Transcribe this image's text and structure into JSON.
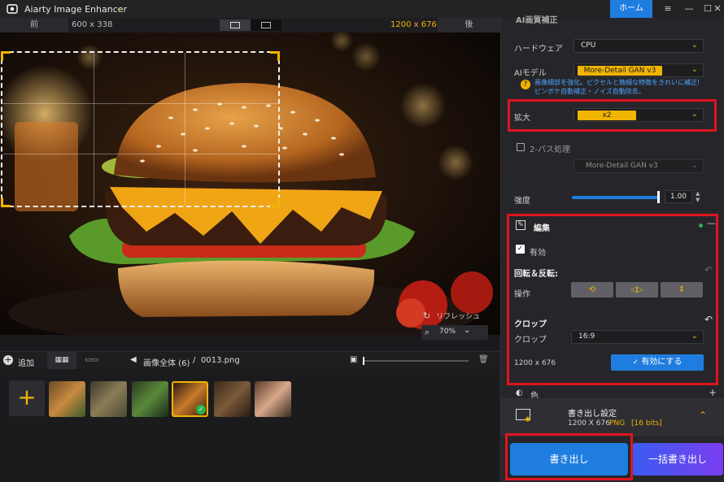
{
  "app": {
    "title": "Aiarty Image Enhancer",
    "home_label": "ホーム",
    "window_controls": [
      "≡",
      "—",
      "☐",
      "✕"
    ]
  },
  "compare": {
    "before_label": "前",
    "before_size": "600 x 338",
    "after_size": "1200 x 676",
    "after_label": "後"
  },
  "canvas": {
    "refresh_label": "リフレッシュ",
    "zoom_value": "70%"
  },
  "bottom": {
    "add_label": "追加",
    "path_all": "画像全体 (6)",
    "path_sep": "/",
    "path_file": "0013.png",
    "thumbs": [
      "tiger",
      "lizard",
      "forest",
      "burger",
      "dog",
      "woman"
    ],
    "selected_thumb": "burger"
  },
  "panel": {
    "section_title_partial": "AI画質補正",
    "hardware_label": "ハードウェア",
    "hardware_value": "CPU",
    "ai_model_label": "AIモデル",
    "ai_model_value": "More-Detail GAN  v3",
    "ai_model_hint_line1": "画像細部を強化。ピクセルと微細な特徴をきれいに補正!",
    "ai_model_hint_line2": "ピンボケ自動補正・ノイズ自動除去。",
    "scale_label": "拡大",
    "scale_value": "x2",
    "two_pass_label": "2-パス処理",
    "two_pass_model": "More-Detail GAN  v3",
    "strength_label": "強度",
    "strength_value": "1.00",
    "edit": {
      "title": "編集",
      "enabled_label": "有効",
      "rotate_flip_label": "回転＆反転:",
      "operation_label": "操作",
      "crop_section_label": "クロップ",
      "crop_label": "クロップ",
      "crop_ratio": "16:9",
      "crop_size": "1200 x 676",
      "apply_button": "有効にする"
    },
    "color_section_label": "色",
    "export_settings": {
      "title": "書き出し設定",
      "size": "1200 X 676",
      "format": "PNG",
      "bits": "[16 bits]"
    },
    "export_button": "書き出し",
    "batch_export_button": "一括書き出し"
  },
  "colors": {
    "accent_yellow": "#f0b400",
    "accent_blue": "#1f7de0",
    "highlight_red": "#e0141e",
    "status_green": "#2bb24c"
  }
}
